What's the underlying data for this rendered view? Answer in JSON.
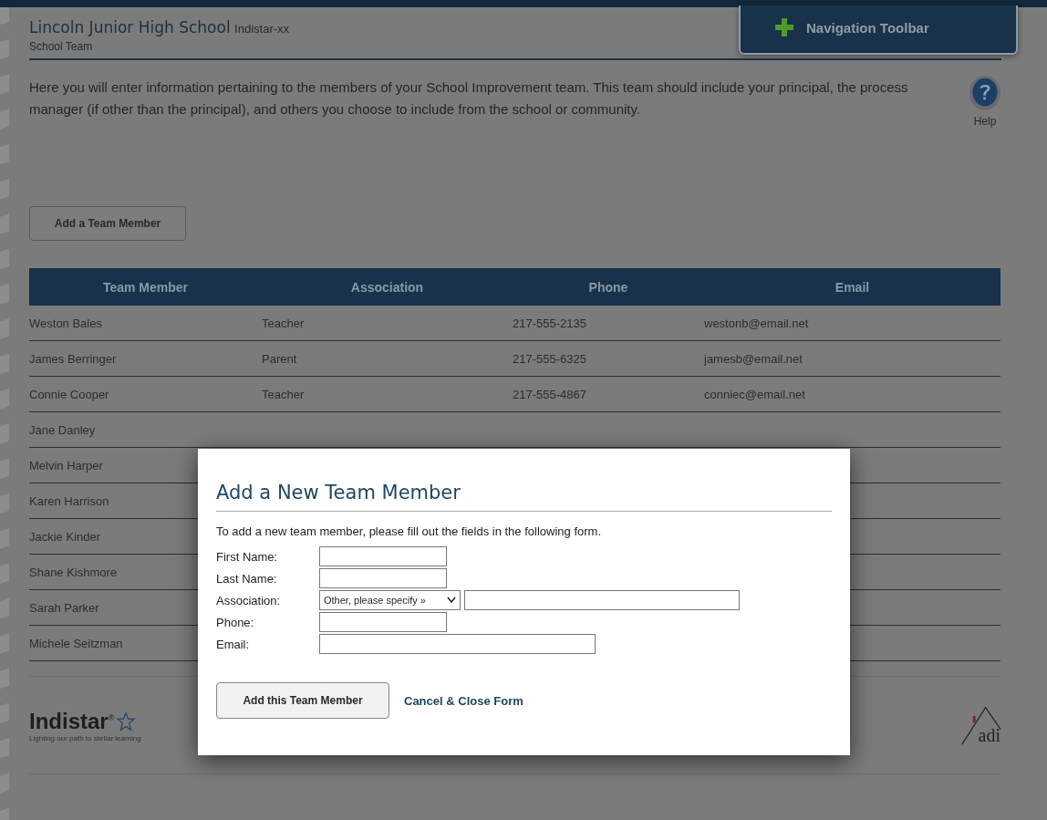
{
  "header": {
    "school": "Lincoln Junior High School",
    "code": "Indistar-xx",
    "section": "School Team"
  },
  "nav_toolbar": {
    "label": "Navigation Toolbar"
  },
  "intro": "Here you will enter information pertaining to the members of your School Improvement team. This team should include your principal, the process manager (if other than the principal), and others you choose to include from the school or community.",
  "help": {
    "label": "Help"
  },
  "add_button": "Add a Team Member",
  "table": {
    "columns": [
      "Team Member",
      "Association",
      "Phone",
      "Email"
    ],
    "rows": [
      {
        "cells": [
          "Weston Bales",
          "Teacher",
          "217-555-2135",
          "westonb@email.net"
        ]
      },
      {
        "cells": [
          "James Berringer",
          "Parent",
          "217-555-6325",
          "jamesb@email.net"
        ]
      },
      {
        "cells": [
          "Connie Cooper",
          "Teacher",
          "217-555-4867",
          "conniec@email.net"
        ]
      },
      {
        "cells": [
          "Jane Danley"
        ]
      },
      {
        "cells": [
          "Melvin Harper"
        ]
      },
      {
        "cells": [
          "Karen Harrison"
        ]
      },
      {
        "cells": [
          "Jackie Kinder"
        ]
      },
      {
        "cells": [
          "Shane Kishmore"
        ]
      },
      {
        "cells": [
          "Sarah Parker"
        ]
      },
      {
        "cells": [
          "Michele Seitzman"
        ]
      }
    ]
  },
  "footer": {
    "logo": "Indistar$^{®}$",
    "tagline": "Lighting our path to stellar learning",
    "partner_logo": "adi"
  },
  "modal": {
    "title": "Add a New Team Member",
    "instruction": "To add a new team member, please fill out the fields in the following form.",
    "fields": [
      {
        "label": "First Name:",
        "kind": "short"
      },
      {
        "label": "Last Name:",
        "kind": "short"
      },
      {
        "label": "Association:",
        "kind": "select",
        "value": "Other, please specify »"
      },
      {
        "label": "Phone:",
        "kind": "short"
      },
      {
        "label": "Email:",
        "kind": "long"
      }
    ],
    "submit": "Add this Team Member",
    "cancel": "Cancel & Close Form"
  }
}
